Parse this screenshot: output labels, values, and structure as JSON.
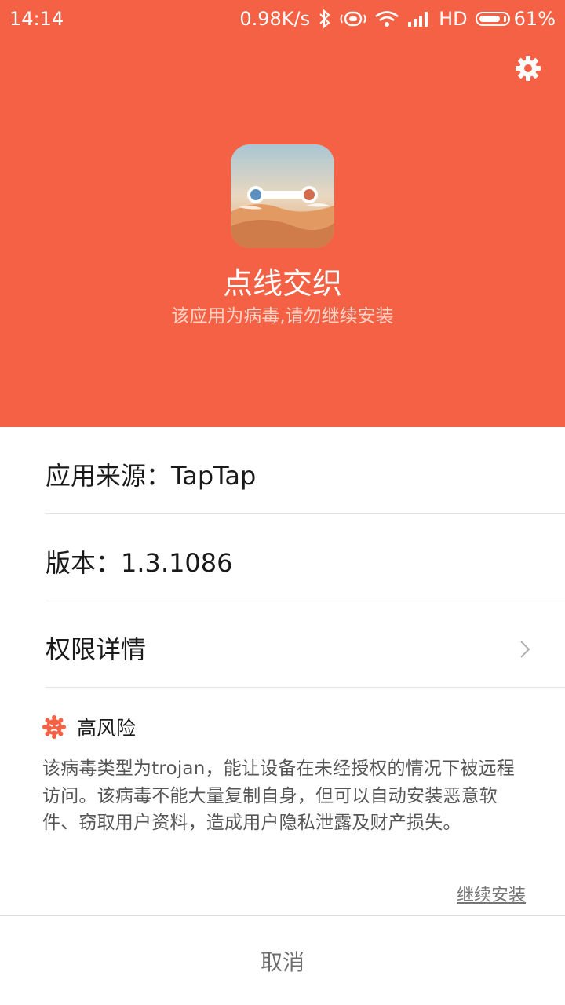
{
  "status_bar": {
    "time": "14:14",
    "speed": "0.98K/s",
    "network": "HD",
    "battery": "61%"
  },
  "header": {
    "app_name": "点线交织",
    "warning": "该应用为病毒,请勿继续安装",
    "bg_color": "#f46144"
  },
  "info": {
    "source_label": "应用来源：TapTap",
    "version_label": "版本：1.3.1086",
    "permissions_label": "权限详情"
  },
  "risk": {
    "level": "高风险",
    "description": "该病毒类型为trojan，能让设备在未经授权的情况下被远程访问。该病毒不能大量复制自身，但可以自动安装恶意软件、窃取用户资料，造成用户隐私泄露及财产损失。"
  },
  "actions": {
    "continue": "继续安装",
    "cancel": "取消"
  }
}
